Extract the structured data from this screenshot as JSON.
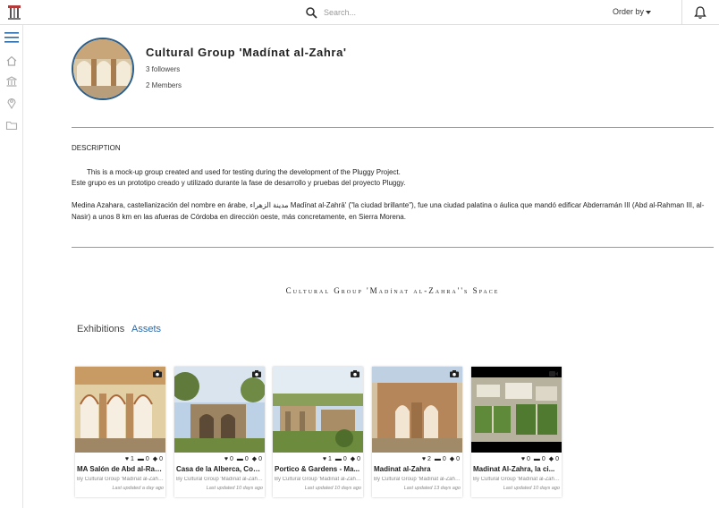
{
  "header": {
    "search_placeholder": "Search...",
    "order_by_label": "Order by"
  },
  "group": {
    "title": "Cultural Group 'Madínat al-Zahra'",
    "followers": "3 followers",
    "members": "2 Members"
  },
  "description": {
    "heading": "DESCRIPTION",
    "paragraph1_line1": "This is a mock-up group created and used for testing during the development of the Pluggy Project.",
    "paragraph1_line2": "Este grupo es un prototipo creado y utilizado durante la fase de desarrollo y pruebas del proyecto Pluggy.",
    "paragraph2": "Medina Azahara, castellanización del nombre en árabe, مدينة الزهراء Madīnat al-Zahrā' (\"la ciudad brillante\"), fue una ciudad palatina o áulica que mandó edificar Abderramán III (Abd al-Rahman III, al-Nasir) a unos 8 km en las afueras de Córdoba en dirección oeste, más concretamente, en Sierra Morena."
  },
  "space_title": "Cultural Group 'Madínat al-Zahra''s Space",
  "tabs": [
    {
      "label": "Exhibitions",
      "active": false
    },
    {
      "label": "Assets",
      "active": true
    }
  ],
  "accent_color": "#2a6aa8",
  "assets": [
    {
      "title": "MA Salón de Abd al-Rahman III",
      "likes": "1",
      "comments": "0",
      "shares": "0",
      "by": "By Cultural Group 'Madínat al-Zahra'",
      "updated": "Last updated a day ago",
      "type_icon": "camera-icon"
    },
    {
      "title": "Casa de la Alberca, Con...",
      "likes": "0",
      "comments": "0",
      "shares": "0",
      "by": "By Cultural Group 'Madínat al-Zahra'",
      "updated": "Last updated 10 days ago",
      "type_icon": "camera-icon"
    },
    {
      "title": "Portico & Gardens - Ma...",
      "likes": "1",
      "comments": "0",
      "shares": "0",
      "by": "By Cultural Group 'Madínat al-Zahra'",
      "updated": "Last updated 10 days ago",
      "type_icon": "camera-icon"
    },
    {
      "title": "Madinat al-Zahra",
      "likes": "2",
      "comments": "0",
      "shares": "0",
      "by": "By Cultural Group 'Madínat al-Zahra'",
      "updated": "Last updated 13 days ago",
      "type_icon": "camera-icon"
    },
    {
      "title": "Madinat Al-Zahra, la ci...",
      "likes": "0",
      "comments": "0",
      "shares": "0",
      "by": "By Cultural Group 'Madínat al-Zahra'",
      "updated": "Last updated 10 days ago",
      "type_icon": "video-icon"
    }
  ]
}
